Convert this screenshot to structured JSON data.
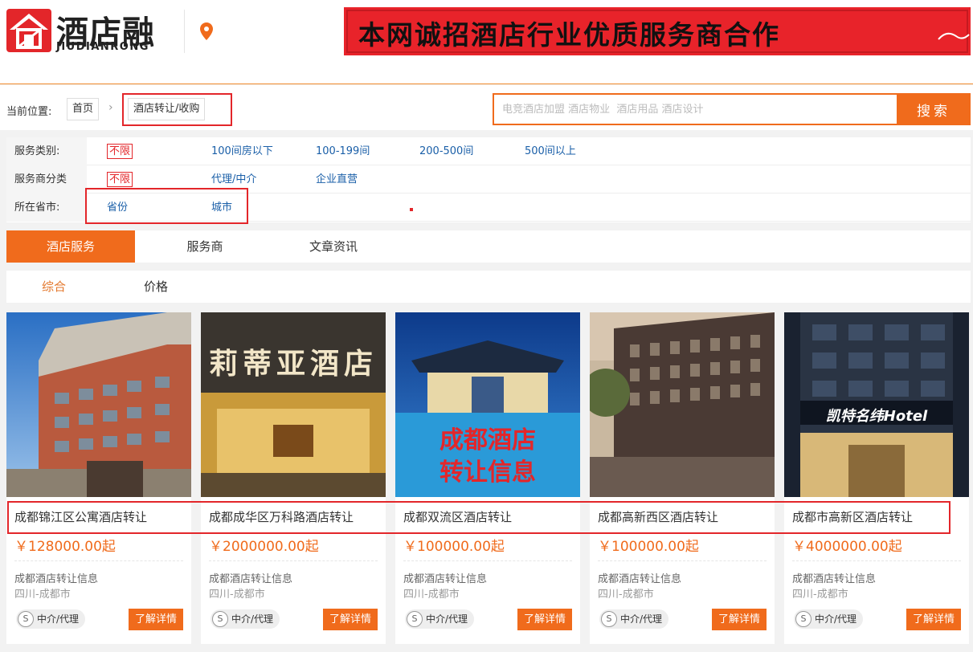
{
  "header": {
    "logo_text": "酒店融",
    "logo_sub": "JIUDIANRONG",
    "banner_text": "本网诚招酒店行业优质服务商合作"
  },
  "breadcrumb": {
    "label": "当前位置:",
    "home": "首页",
    "current": "酒店转让/收购"
  },
  "search": {
    "placeholder": "电竞酒店加盟 酒店物业  酒店用品 酒店设计",
    "button": "搜索"
  },
  "filters": {
    "service_type": {
      "label": "服务类别:",
      "options": [
        "不限",
        "100间房以下",
        "100-199间",
        "200-500间",
        "500间以上"
      ]
    },
    "provider_type": {
      "label": "服务商分类",
      "options": [
        "不限",
        "代理/中介",
        "企业直营"
      ]
    },
    "province": {
      "label": "所在省市:",
      "options": [
        "省份",
        "城市"
      ]
    }
  },
  "tabs": [
    "酒店服务",
    "服务商",
    "文章资讯"
  ],
  "subtabs": [
    "综合",
    "价格"
  ],
  "cards": [
    {
      "title": "成都锦江区公寓酒店转让",
      "price": "￥128000.00起",
      "category": "成都酒店转让信息",
      "location": "四川-成都市",
      "badge_icon": "S",
      "badge": "中介/代理",
      "button": "了解详情"
    },
    {
      "title": "成都成华区万科路酒店转让",
      "price": "￥2000000.00起",
      "category": "成都酒店转让信息",
      "location": "四川-成都市",
      "badge_icon": "S",
      "badge": "中介/代理",
      "button": "了解详情",
      "sign_text": "莉蒂亚酒店"
    },
    {
      "title": "成都双流区酒店转让",
      "price": "￥100000.00起",
      "category": "成都酒店转让信息",
      "location": "四川-成都市",
      "badge_icon": "S",
      "badge": "中介/代理",
      "button": "了解详情",
      "overlay_line1": "成都酒店",
      "overlay_line2": "转让信息"
    },
    {
      "title": "成都高新西区酒店转让",
      "price": "￥100000.00起",
      "category": "成都酒店转让信息",
      "location": "四川-成都市",
      "badge_icon": "S",
      "badge": "中介/代理",
      "button": "了解详情"
    },
    {
      "title": "成都市高新区酒店转让",
      "price": "￥4000000.00起",
      "category": "成都酒店转让信息",
      "location": "四川-成都市",
      "badge_icon": "S",
      "badge": "中介/代理",
      "button": "了解详情",
      "sign_text": "凯特名纬Hotel"
    }
  ]
}
